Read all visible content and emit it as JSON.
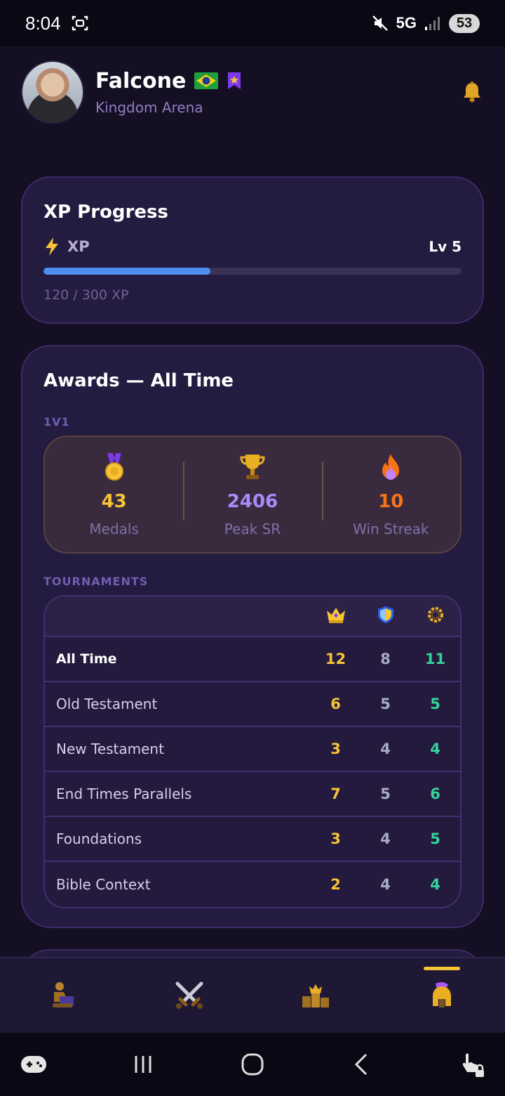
{
  "status_bar": {
    "time": "8:04",
    "network": "5G",
    "battery": "53"
  },
  "profile": {
    "name": "Falcone",
    "arena": "Kingdom Arena",
    "flag_icon": "brazil-flag-icon",
    "badge_icon": "purple-ribbon-icon",
    "notification_icon": "bell-icon"
  },
  "xp_card": {
    "title": "XP Progress",
    "label": "XP",
    "level": "Lv 5",
    "progress_text": "120 / 300 XP",
    "current_xp": 120,
    "max_xp": 300,
    "progress_fraction": 0.4
  },
  "awards_card": {
    "title": "Awards — All Time",
    "section_1v1": "1V1",
    "stats": [
      {
        "icon": "medal-icon",
        "value": "43",
        "label": "Medals",
        "color": "#f6c438"
      },
      {
        "icon": "trophy-icon",
        "value": "2406",
        "label": "Peak SR",
        "color": "#a78bfa"
      },
      {
        "icon": "flame-icon",
        "value": "10",
        "label": "Win Streak",
        "color": "#f97316"
      }
    ],
    "section_tournaments": "TOURNAMENTS",
    "columns": [
      "crown-icon",
      "shield-icon",
      "laurel-icon"
    ],
    "rows": [
      {
        "name": "All Time",
        "gold": "12",
        "silver": "8",
        "green": "11"
      },
      {
        "name": "Old Testament",
        "gold": "6",
        "silver": "5",
        "green": "5"
      },
      {
        "name": "New Testament",
        "gold": "3",
        "silver": "4",
        "green": "4"
      },
      {
        "name": "End Times Parallels",
        "gold": "7",
        "silver": "5",
        "green": "6"
      },
      {
        "name": "Foundations",
        "gold": "3",
        "silver": "4",
        "green": "5"
      },
      {
        "name": "Bible Context",
        "gold": "2",
        "silver": "4",
        "green": "4"
      }
    ]
  },
  "bottom_nav": {
    "items": [
      "reading-icon",
      "crossed-swords-icon",
      "crown-arena-icon",
      "spartan-helmet-icon"
    ],
    "active_index": 3
  },
  "system_nav": {
    "items": [
      "gamepad-icon",
      "recents-icon",
      "home-icon",
      "back-icon",
      "touch-lock-icon"
    ]
  }
}
